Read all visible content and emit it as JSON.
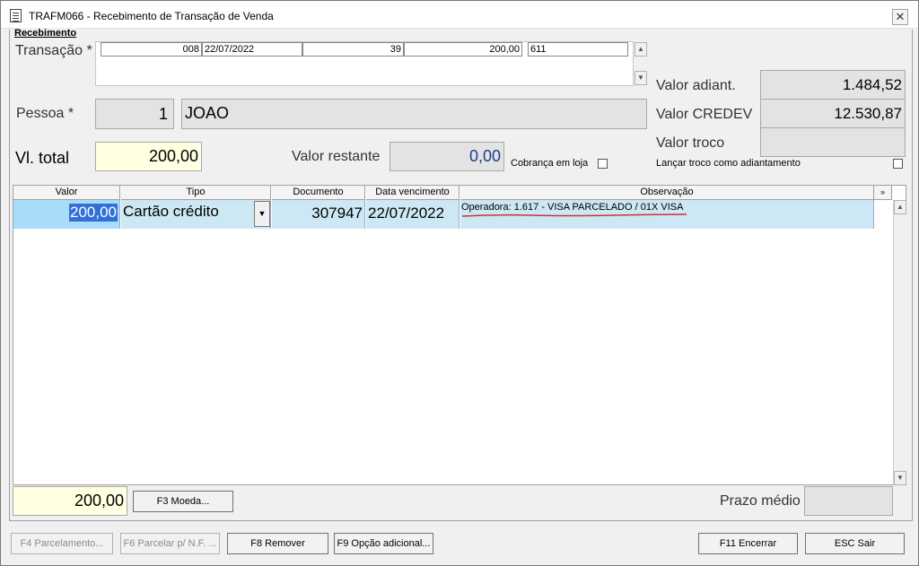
{
  "window": {
    "title": "TRAFM066 - Recebimento de Transação de Venda",
    "close_glyph": "✕"
  },
  "group": {
    "label": "Recebimento"
  },
  "transacao": {
    "label": "Transação *",
    "fields": [
      "008",
      "22/07/2022",
      "39",
      "200,00",
      "611"
    ]
  },
  "pessoa": {
    "label": "Pessoa *",
    "code": "1",
    "name": "JOAO"
  },
  "vl_total": {
    "label": "Vl. total",
    "value": "200,00"
  },
  "valor_restante": {
    "label": "Valor restante",
    "value": "0,00"
  },
  "cobranca": {
    "label": "Cobrança em loja"
  },
  "valor_adiant": {
    "label": "Valor adiant.",
    "value": "1.484,52"
  },
  "valor_credev": {
    "label": "Valor CREDEV",
    "value": "12.530,87"
  },
  "valor_troco": {
    "label": "Valor troco",
    "value": ""
  },
  "lancar_troco": {
    "label": "Lançar troco como adiantamento"
  },
  "grid": {
    "columns": [
      "Valor",
      "Tipo",
      "Documento",
      "Data vencimento",
      "Observação"
    ],
    "rows": [
      {
        "valor": "200,00",
        "tipo": "Cartão crédito",
        "documento": "307947",
        "data": "22/07/2022",
        "observacao": "Operadora: 1.617 - VISA PARCELADO / 01X VISA"
      }
    ],
    "annotation_color": "#d03030"
  },
  "footer": {
    "total": "200,00",
    "moeda_button": "F3 Moeda...",
    "prazo_label": "Prazo médio",
    "prazo_value": ""
  },
  "buttons": {
    "parcelamento": "F4 Parcelamento...",
    "parcelar_nf": "F6 Parcelar p/ N.F. ...",
    "remover": "F8 Remover",
    "opcao": "F9 Opção adicional...",
    "encerrar": "F11 Encerrar",
    "sair": "ESC Sair"
  }
}
